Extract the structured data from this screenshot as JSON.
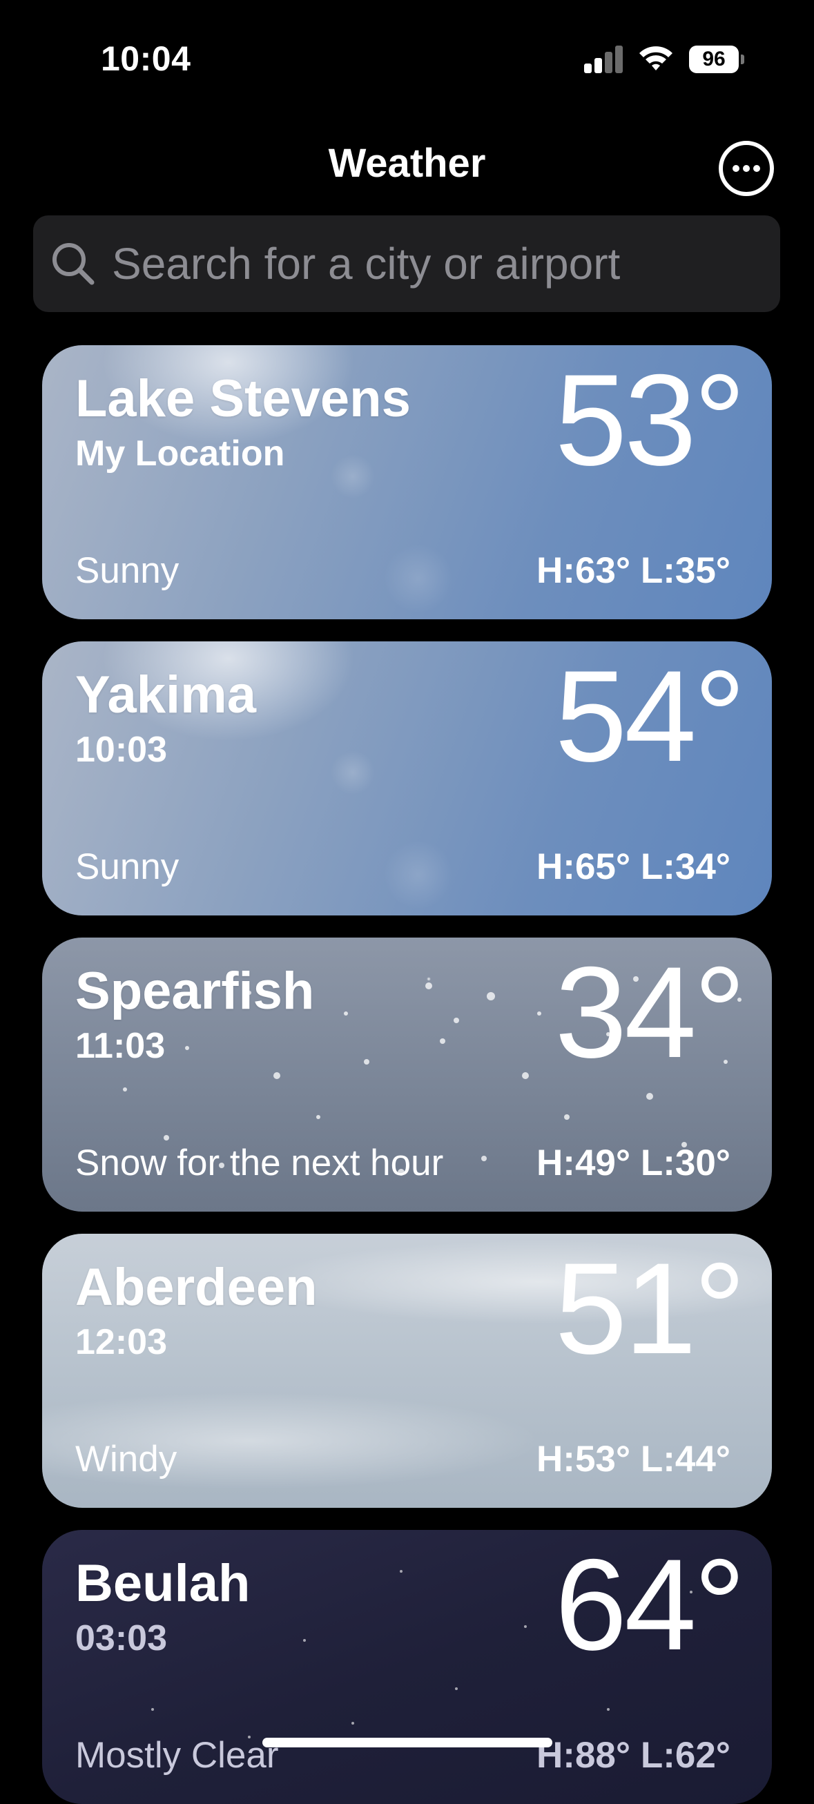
{
  "status_bar": {
    "time": "10:04",
    "battery": "96"
  },
  "header": {
    "title": "Weather",
    "more_icon": "ellipsis-circle-icon"
  },
  "search": {
    "placeholder": "Search for a city or airport",
    "value": ""
  },
  "locations": [
    {
      "city": "Lake Stevens",
      "subtitle": "My Location",
      "temp": "53°",
      "condition": "Sunny",
      "hilo": "H:63°  L:35°",
      "theme": "sunny"
    },
    {
      "city": "Yakima",
      "subtitle": "10:03",
      "temp": "54°",
      "condition": "Sunny",
      "hilo": "H:65°  L:34°",
      "theme": "sunny"
    },
    {
      "city": "Spearfish",
      "subtitle": "11:03",
      "temp": "34°",
      "condition": "Snow for the next hour",
      "hilo": "H:49°  L:30°",
      "theme": "snow"
    },
    {
      "city": "Aberdeen",
      "subtitle": "12:03",
      "temp": "51°",
      "condition": "Windy",
      "hilo": "H:53°  L:44°",
      "theme": "windy"
    },
    {
      "city": "Beulah",
      "subtitle": "03:03",
      "temp": "64°",
      "condition": "Mostly Clear",
      "hilo": "H:88°  L:62°",
      "theme": "night"
    }
  ]
}
